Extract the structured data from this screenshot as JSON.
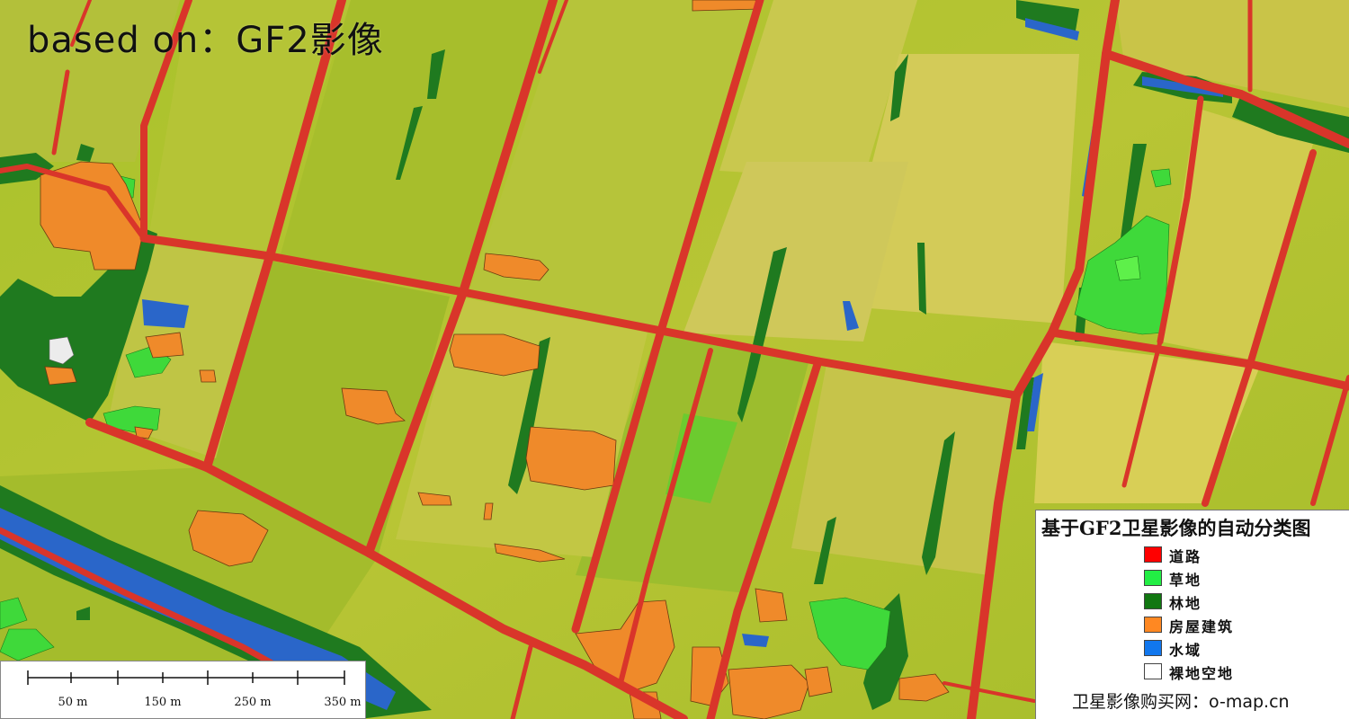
{
  "map_title": "based on：GF2影像",
  "legend": {
    "title": "基于GF2卫星影像的自动分类图",
    "items": [
      {
        "label": "道路",
        "color": "#ff0000"
      },
      {
        "label": "草地",
        "color": "#22ee44"
      },
      {
        "label": "林地",
        "color": "#117711"
      },
      {
        "label": "房屋建筑",
        "color": "#ff8822"
      },
      {
        "label": "水域",
        "color": "#1177ee"
      },
      {
        "label": "裸地空地",
        "color": "#ffffff"
      }
    ],
    "footer": "卫星影像购买网：o-map.cn"
  },
  "scale_bar": {
    "labels": [
      "50 m",
      "150 m",
      "250 m",
      "350 m"
    ]
  },
  "colors": {
    "road": "#d9352a",
    "grass": "#3fd93a",
    "forest": "#1f7a1f",
    "building": "#ef8a2a",
    "water": "#2a66c9",
    "bare": "#ececec",
    "cropland_light": "#d6cf52",
    "cropland_green": "#9fbf2a"
  }
}
